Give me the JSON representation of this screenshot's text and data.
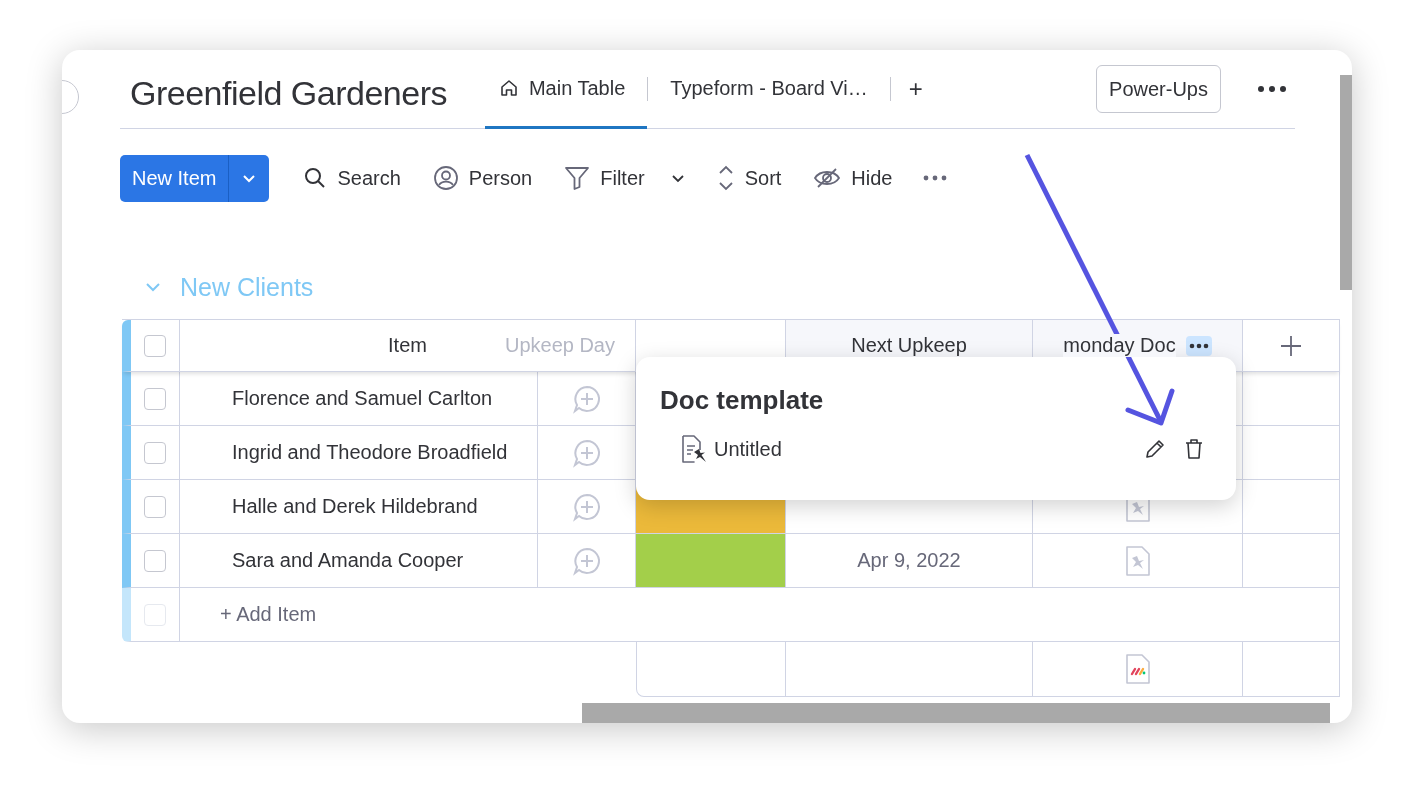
{
  "board": {
    "title": "Greenfield Gardeners"
  },
  "tabs": [
    {
      "label": "Main Table",
      "kind": "home",
      "selected": true
    },
    {
      "label": "Typeform - Board Vi…",
      "kind": "view",
      "selected": false
    }
  ],
  "add_tab": "+",
  "power_ups": "Power-Ups",
  "new_item": "New Item",
  "toolbar": [
    {
      "label": "Search",
      "kind": "search"
    },
    {
      "label": "Person",
      "kind": "person"
    },
    {
      "label": "Filter",
      "kind": "filter"
    },
    {
      "label": "Sort",
      "kind": "sort"
    },
    {
      "label": "Hide",
      "kind": "hide"
    }
  ],
  "group": {
    "title": "New Clients",
    "expanded": true,
    "all_checked": false,
    "columns": {
      "item": "Item",
      "ghost": "Upkeep Day",
      "date": "Next Upkeep",
      "doc": "monday Doc"
    },
    "rows": [
      {
        "name": "Florence and Samuel Carlton",
        "checked": false
      },
      {
        "name": "Ingrid and Theodore Broadfield",
        "checked": false
      },
      {
        "name": "Halle and Derek Hildebrand",
        "checked": false,
        "color": "#ebb93a",
        "doc": true
      },
      {
        "name": "Sara and Amanda Cooper",
        "checked": false,
        "color": "#a3cf4a",
        "date": "Apr 9, 2022",
        "doc": true
      }
    ],
    "add_item": "+ Add Item"
  },
  "popup": {
    "title": "Doc template",
    "items": [
      {
        "label": "Untitled"
      }
    ]
  }
}
